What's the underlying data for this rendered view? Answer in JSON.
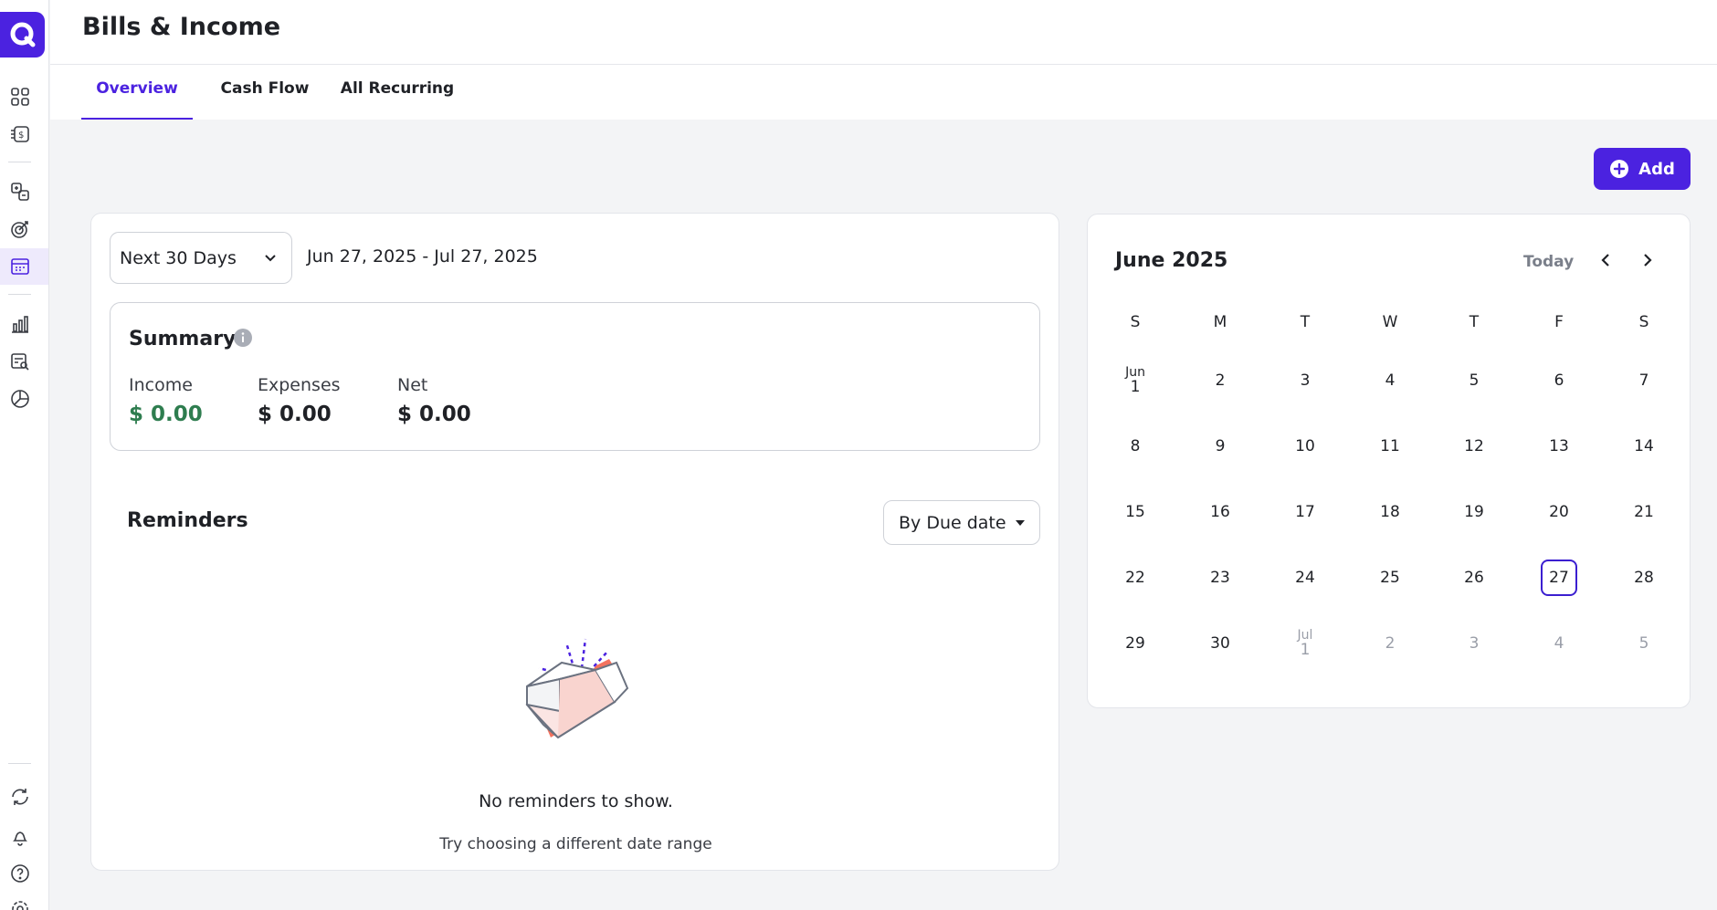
{
  "header": {
    "title": "Bills & Income"
  },
  "tabs": [
    {
      "label": "Overview",
      "active": true
    },
    {
      "label": "Cash Flow",
      "active": false
    },
    {
      "label": "All Recurring",
      "active": false
    }
  ],
  "toolbar": {
    "add_label": "Add"
  },
  "range": {
    "selected": "Next 30 Days",
    "dates": "Jun 27, 2025 - Jul 27, 2025"
  },
  "summary": {
    "title": "Summary",
    "income_label": "Income",
    "income_value": "$ 0.00",
    "expenses_label": "Expenses",
    "expenses_value": "$ 0.00",
    "net_label": "Net",
    "net_value": "$ 0.00"
  },
  "reminders": {
    "title": "Reminders",
    "sort_label": "By Due date",
    "empty_title": "No reminders to show.",
    "empty_subtitle": "Try choosing a different date range"
  },
  "calendar": {
    "title": "June 2025",
    "today_label": "Today",
    "weekdays": [
      "S",
      "M",
      "T",
      "W",
      "T",
      "F",
      "S"
    ],
    "weeks": [
      [
        {
          "m": "Jun",
          "d": "1"
        },
        {
          "d": "2"
        },
        {
          "d": "3"
        },
        {
          "d": "4"
        },
        {
          "d": "5"
        },
        {
          "d": "6"
        },
        {
          "d": "7"
        }
      ],
      [
        {
          "d": "8"
        },
        {
          "d": "9"
        },
        {
          "d": "10"
        },
        {
          "d": "11"
        },
        {
          "d": "12"
        },
        {
          "d": "13"
        },
        {
          "d": "14"
        }
      ],
      [
        {
          "d": "15"
        },
        {
          "d": "16"
        },
        {
          "d": "17"
        },
        {
          "d": "18"
        },
        {
          "d": "19"
        },
        {
          "d": "20"
        },
        {
          "d": "21"
        }
      ],
      [
        {
          "d": "22"
        },
        {
          "d": "23"
        },
        {
          "d": "24"
        },
        {
          "d": "25"
        },
        {
          "d": "26"
        },
        {
          "d": "27",
          "today": true
        },
        {
          "d": "28"
        }
      ],
      [
        {
          "d": "29"
        },
        {
          "d": "30"
        },
        {
          "m": "Jul",
          "d": "1",
          "out": true
        },
        {
          "d": "2",
          "out": true
        },
        {
          "d": "3",
          "out": true
        },
        {
          "d": "4",
          "out": true
        },
        {
          "d": "5",
          "out": true
        }
      ]
    ]
  },
  "colors": {
    "accent": "#4b22e0",
    "income": "#2e7d4f",
    "illustration": "#f4725f"
  },
  "sidebar": {
    "icons": [
      "dashboard-icon",
      "transactions-icon",
      "accounts-icon",
      "goals-icon",
      "bills-icon",
      "reports-icon",
      "investments-icon",
      "budgets-icon",
      "sync-icon",
      "notifications-icon",
      "help-icon",
      "settings-icon"
    ]
  }
}
